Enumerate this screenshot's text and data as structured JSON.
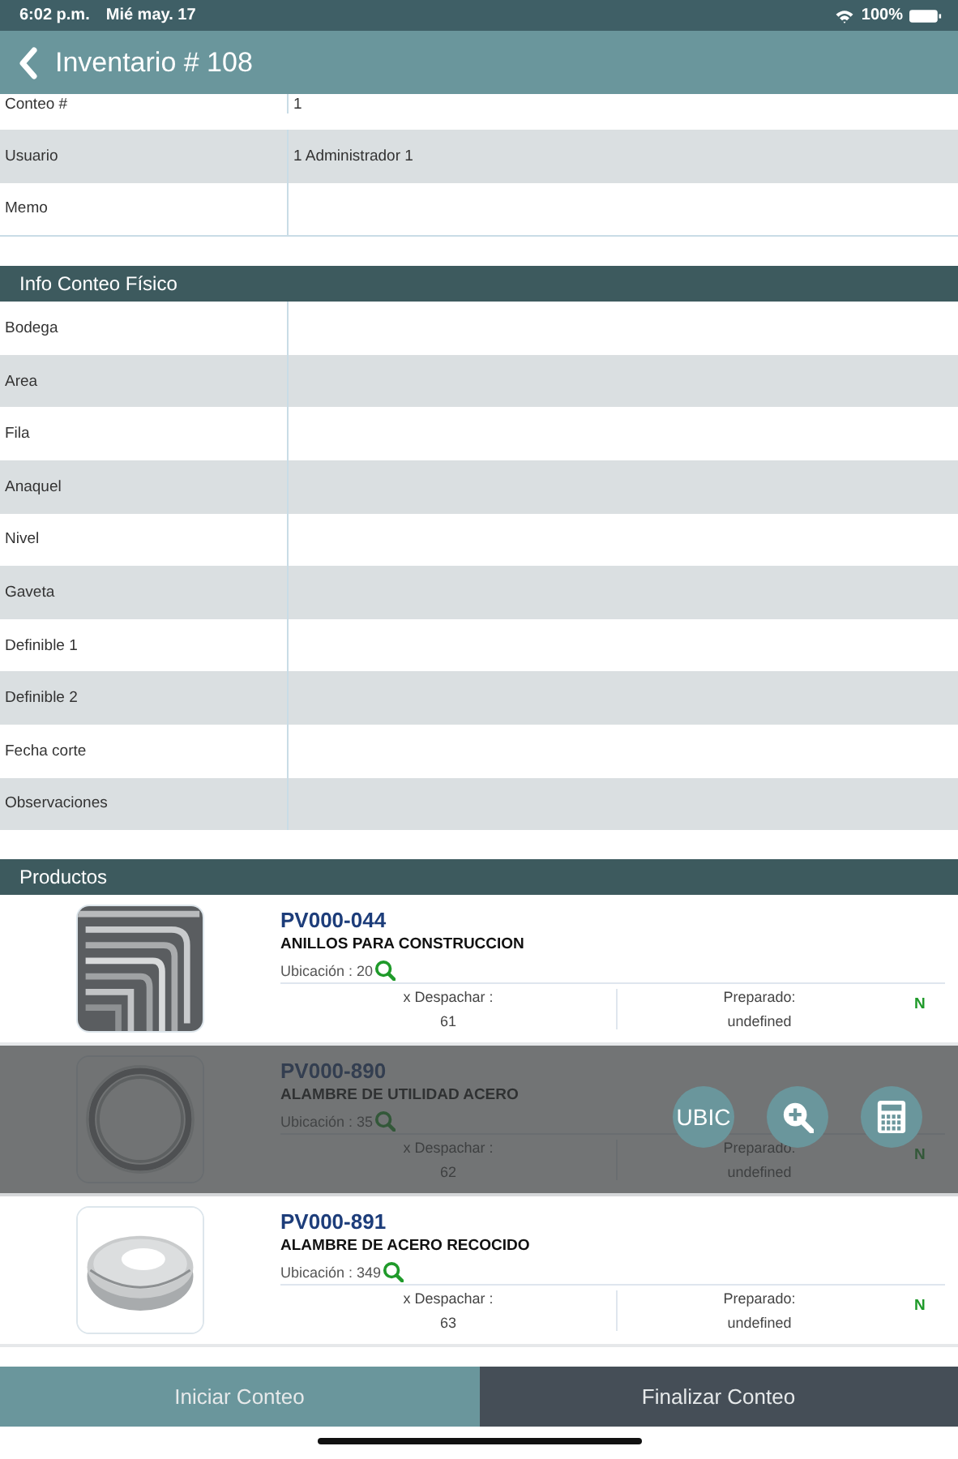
{
  "status_bar": {
    "time": "6:02 p.m.",
    "date": "Mié may. 17",
    "battery": "100%"
  },
  "header": {
    "title": "Inventario # 108"
  },
  "form": [
    {
      "label": "Conteo #",
      "value": "1"
    },
    {
      "label": "Usuario",
      "value": "1 Administrador 1"
    },
    {
      "label": "Memo"
    }
  ],
  "sections": [
    {
      "title": "Info Conteo Físico",
      "fields": [
        {
          "label": "Bodega"
        },
        {
          "label": "Area"
        },
        {
          "label": "Fila"
        },
        {
          "label": "Anaquel"
        },
        {
          "label": "Nivel"
        },
        {
          "label": "Gaveta"
        },
        {
          "label": "Definible 1"
        },
        {
          "label": "Definible 2"
        },
        {
          "label": "Fecha corte"
        },
        {
          "label": "Observaciones"
        }
      ]
    }
  ],
  "products": {
    "title": "Productos",
    "items": [
      {
        "code": "PV000-044",
        "name": "ANILLOS PARA CONSTRUCCION",
        "location": "Ubicación : 20",
        "dispatch_label": "x Despachar :",
        "dispatch": "61",
        "prepared_label": "Preparado:",
        "prepared": "undefined",
        "flag": "N",
        "actions_open": false
      },
      {
        "code": "PV000-890",
        "name": "ALAMBRE DE UTILIDAD ACERO",
        "location": "Ubicación : 35",
        "dispatch_label": "x Despachar :",
        "dispatch": "62",
        "prepared_label": "Preparado:",
        "prepared": "undefined",
        "flag": "N",
        "actions_open": true,
        "actions": [
          {
            "kind": "text",
            "label": "UBIC"
          },
          {
            "kind": "zoom"
          },
          {
            "kind": "calculator"
          }
        ]
      },
      {
        "code": "PV000-891",
        "name": "ALAMBRE DE ACERO RECOCIDO",
        "location": "Ubicación : 349",
        "dispatch_label": "x Despachar :",
        "dispatch": "63",
        "prepared_label": "Preparado:",
        "prepared": "undefined",
        "flag": "N",
        "actions_open": false
      }
    ]
  },
  "footer": [
    {
      "label": "Iniciar Conteo",
      "selected": true
    },
    {
      "label": "Finalizar Conteo",
      "selected": false
    }
  ]
}
